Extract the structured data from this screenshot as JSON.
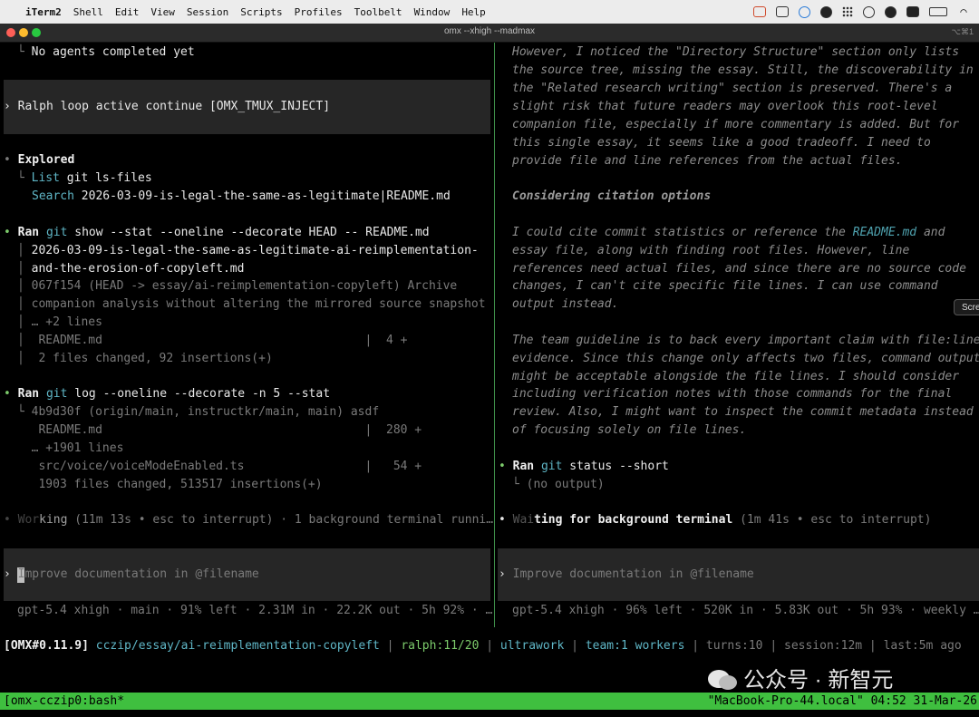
{
  "menubar": {
    "app": "iTerm2",
    "items": [
      "Shell",
      "Edit",
      "View",
      "Session",
      "Scripts",
      "Profiles",
      "Toolbelt",
      "Window",
      "Help"
    ]
  },
  "window": {
    "title": "omx --xhigh --madmax",
    "shortcut": "⌥⌘1"
  },
  "left_pane": {
    "l1_branch": "└ ",
    "l1_text": "No agents completed yet",
    "ralph_prompt": "› Ralph loop active continue [OMX_TMUX_INJECT]",
    "explored_bullet": "• ",
    "explored_label": "Explored",
    "list_branch": "└ ",
    "list_label": "List",
    "list_text": " git ls-files",
    "search_label": "Search",
    "search_text": " 2026-03-09-is-legal-the-same-as-legitimate|README.md",
    "ran1_label": "Ran",
    "ran1_cmd_git": " git",
    "ran1_cmd": " show --stat --oneline --decorate HEAD -- README.md",
    "ran1_l2": "2026-03-09-is-legal-the-same-as-legitimate-ai-reimplementation-",
    "ran1_l3": "and-the-erosion-of-copyleft.md",
    "ran1_l4": "067f154 (HEAD -> essay/ai-reimplementation-copyleft) Archive",
    "ran1_l5": "companion analysis without altering the mirrored source snapshot",
    "ran1_l6": "… +2 lines",
    "ran1_l7": "README.md                                     |  4 +",
    "ran1_l8": "2 files changed, 92 insertions(+)",
    "ran2_label": "Ran",
    "ran2_cmd_git": " git",
    "ran2_cmd": " log --oneline --decorate -n 5 --stat",
    "ran2_l2": "4b9d30f (origin/main, instructkr/main, main) asdf",
    "ran2_l3": "README.md                                     |  280 +",
    "ran2_l4": "… +1901 lines",
    "ran2_l5": "src/voice/voiceModeEnabled.ts                 |   54 +",
    "ran2_l6": "1903 files changed, 513517 insertions(+)",
    "working_a": "• Wor",
    "working_b": "king",
    "working_c": " (11m 13s • esc to interrupt) · 1 background terminal runni…",
    "input_chev": "› ",
    "input_placeholder": "Improve documentation in @filename",
    "footer": "gpt-5.4 xhigh · main · 91% left · 2.31M in · 22.2K out · 5h 92% · …"
  },
  "right_pane": {
    "p1_1": "However, I noticed the \"Directory Structure\" section only lists",
    "p1_2": "the source tree, missing the essay. Still, the discoverability in",
    "p1_3": "the \"Related research writing\" section is preserved. There's a",
    "p1_4": "slight risk that future readers may overlook this root-level",
    "p1_5": "companion file, especially if more commentary is added. But for",
    "p1_6": "this single essay, it seems like a good tradeoff. I need to",
    "p1_7": "provide file and line references from the actual files.",
    "heading": "Considering citation options",
    "p2_1a": "I could cite commit statistics or reference the ",
    "p2_1link": "README.md",
    "p2_1b": " and",
    "p2_2": "essay file, along with finding root files. However, line",
    "p2_3": "references need actual files, and since there are no source code",
    "p2_4": "changes, I can't cite specific file lines. I can use command",
    "p2_5": "output instead.",
    "p3_1": "The team guideline is to back every important claim with file:line",
    "p3_2": "evidence. Since this change only affects two files, command output",
    "p3_3": "might be acceptable alongside the file lines. I should consider",
    "p3_4": "including verification notes with those commands for the final",
    "p3_5": "review. Also, I might want to inspect the commit metadata instead",
    "p3_6": "of focusing solely on file lines.",
    "ran_label": "Ran",
    "ran_git": " git",
    "ran_cmd": " status --short",
    "ran_out": "└ (no output)",
    "waiting_a": "Wai",
    "waiting_b": "ting for background terminal",
    "waiting_c": " (1m 41s • esc to interrupt)",
    "input_chev": "› ",
    "input_placeholder": "Improve documentation in @filename",
    "footer": "gpt-5.4 xhigh · 96% left · 520K in · 5.83K out · 5h 93% · weekly …",
    "screenshot_btn": "Scre"
  },
  "statusbar": {
    "version": "[OMX#0.11.9]",
    "path": "cczip/essay/ai-reimplementation-copyleft",
    "ralph": "ralph:11/20",
    "ultrawork": "ultrawork",
    "team": "team:1 workers",
    "turns": "turns:10",
    "session": "session:12m",
    "last": "last:5m ago"
  },
  "tmux": {
    "session": "[omx-cczip0:bash*",
    "host": "\"MacBook-Pro-44.local\" 04:52 31-Mar-26"
  },
  "watermark": "公众号 · 新智元"
}
